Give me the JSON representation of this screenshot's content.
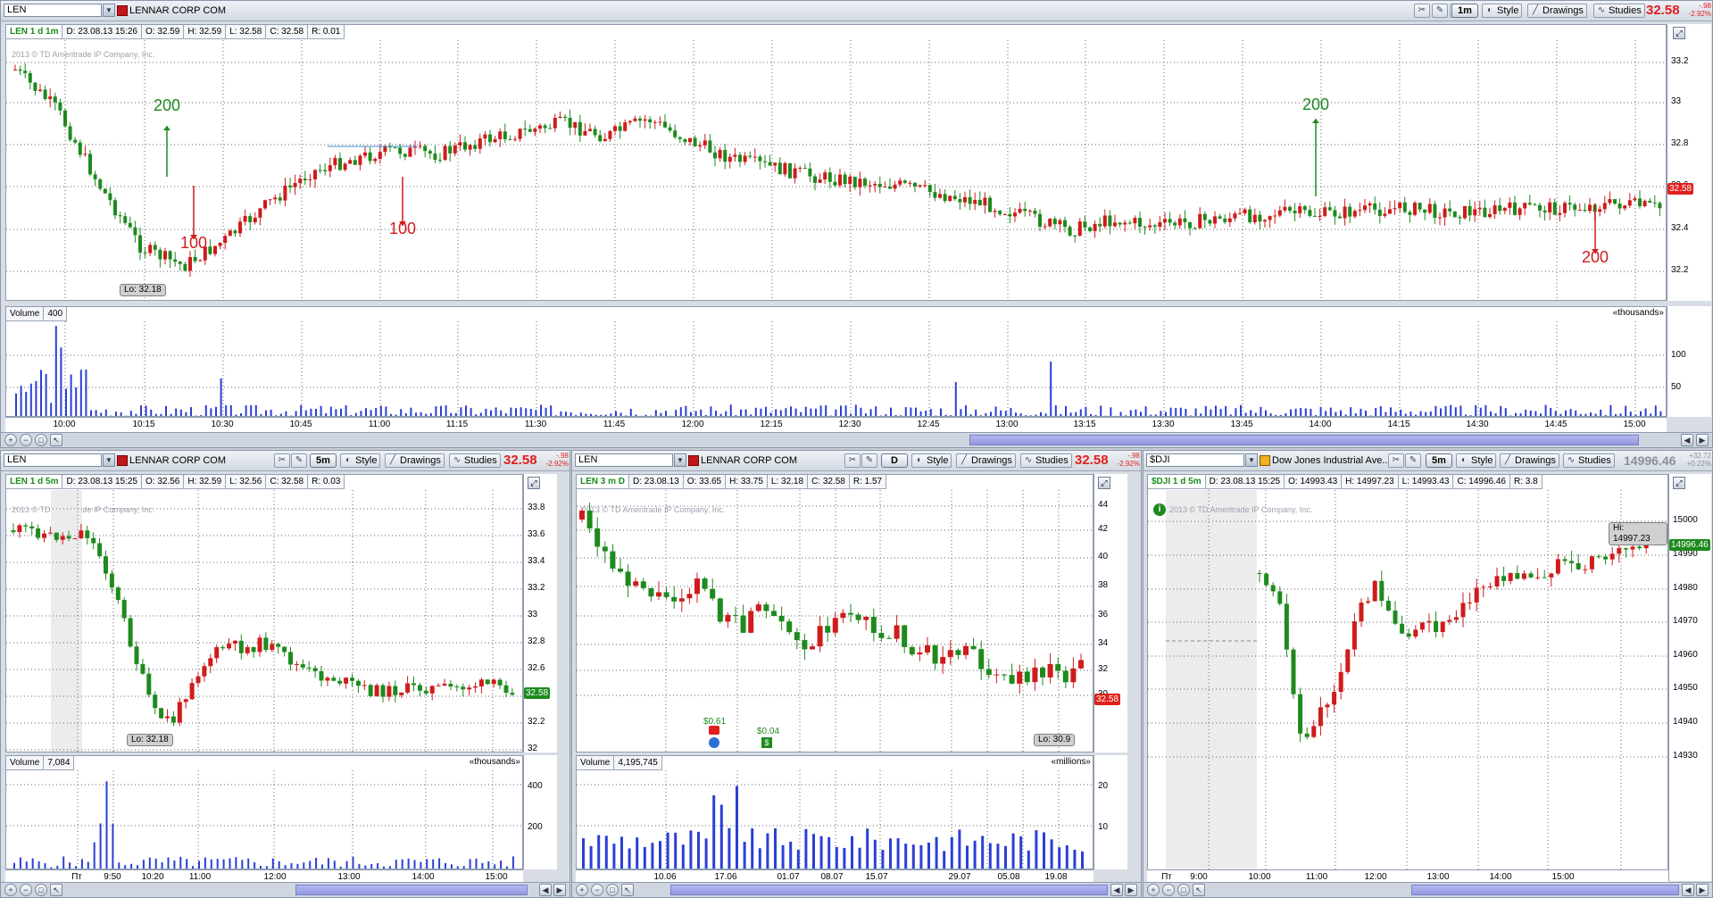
{
  "colors": {
    "up": "#1e8a1e",
    "down": "#cf1b1b",
    "volume": "#2a3fd6",
    "last_bg": "#e0201c",
    "last_bg_dji": "#1e8a1e"
  },
  "toolbar": {
    "style": "Style",
    "drawings": "Drawings",
    "studies": "Studies"
  },
  "top": {
    "symbol": "LEN",
    "company": "LENNAR CORP COM",
    "aggregation": "1m",
    "last": "32.58",
    "chg": "-.98",
    "chg_pct": "-2.92%",
    "info": {
      "title": "LEN 1 d 1m",
      "d": "D: 23.08.13 15:26",
      "o": "O: 32.59",
      "h": "H: 32.59",
      "l": "L: 32.58",
      "c": "C: 32.58",
      "r": "R: 0.01"
    },
    "copyright": "2013 © TD Ameritrade IP Company, Inc.",
    "yticks": [
      "33.2",
      "33",
      "32.8",
      "32.6",
      "32.4",
      "32.2"
    ],
    "price_tag": "32.58",
    "lo": "Lo: 32.18",
    "annotations": [
      {
        "text": "200",
        "color": "up"
      },
      {
        "text": "100",
        "color": "down"
      },
      {
        "text": "100",
        "color": "down"
      },
      {
        "text": "200",
        "color": "up"
      },
      {
        "text": "200",
        "color": "down"
      }
    ],
    "volume": {
      "label": "Volume",
      "value": "400",
      "unit": "«thousands»",
      "ticks": [
        "100",
        "50"
      ]
    },
    "xticks": [
      "10:00",
      "10:15",
      "10:30",
      "10:45",
      "11:00",
      "11:15",
      "11:30",
      "11:45",
      "12:00",
      "12:15",
      "12:30",
      "12:45",
      "13:00",
      "13:15",
      "13:30",
      "13:45",
      "14:00",
      "14:15",
      "14:30",
      "14:45",
      "15:00"
    ]
  },
  "bl": {
    "symbol": "LEN",
    "company": "LENNAR CORP COM",
    "aggregation": "5m",
    "last": "32.58",
    "chg": "-.98",
    "chg_pct": "-2.92%",
    "info": {
      "title": "LEN 1 d 5m",
      "d": "D: 23.08.13 15:25",
      "o": "O: 32.56",
      "h": "H: 32.59",
      "l": "L: 32.56",
      "c": "C: 32.58",
      "r": "R: 0.03"
    },
    "copyright": "2013 © TD Ameritrade IP Company, Inc.",
    "yticks": [
      "33.8",
      "33.6",
      "33.4",
      "33.2",
      "33",
      "32.8",
      "32.6",
      "32.4",
      "32.2",
      "32"
    ],
    "price_tag": "32.58",
    "lo": "Lo: 32.18",
    "volume": {
      "label": "Volume",
      "value": "7,084",
      "unit": "«thousands»",
      "ticks": [
        "400",
        "200"
      ]
    },
    "xticks": [
      "Пт",
      "9:50",
      "10:20",
      "11:00",
      "12:00",
      "13:00",
      "14:00",
      "15:00"
    ]
  },
  "bm": {
    "symbol": "LEN",
    "company": "LENNAR CORP COM",
    "aggregation": "D",
    "last": "32.58",
    "chg": "-.98",
    "chg_pct": "-2.92%",
    "info": {
      "title": "LEN 3 m D",
      "d": "D: 23.08.13",
      "o": "O: 33.65",
      "h": "H: 33.75",
      "l": "L: 32.18",
      "c": "C: 32.58",
      "r": "R: 1.57"
    },
    "copyright": "2013 © TD Ameritrade IP Company, Inc.",
    "yticks": [
      "44",
      "42",
      "40",
      "38",
      "36",
      "34",
      "32",
      "30"
    ],
    "price_tag": "32.58",
    "lo": "Lo: 30.9",
    "div1": "$0.61",
    "div2": "$0.04",
    "volume": {
      "label": "Volume",
      "value": "4,195,745",
      "unit": "«millions»",
      "ticks": [
        "20",
        "10"
      ]
    },
    "xticks": [
      "10.06",
      "17.06",
      "01.07",
      "08.07",
      "15.07",
      "29.07",
      "05.08",
      "19.08"
    ]
  },
  "br": {
    "symbol": "$DJI",
    "company": "Dow Jones Industrial Ave...",
    "aggregation": "5m",
    "last": "14996.46",
    "chg": "+32.72",
    "chg_pct": "+0.22%",
    "info": {
      "title": "$DJI 1 d 5m",
      "d": "D: 23.08.13 15:25",
      "o": "O: 14993.43",
      "h": "H: 14997.23",
      "l": "L: 14993.43",
      "c": "C: 14996.46",
      "r": "R: 3.8"
    },
    "copyright": "2013 © TD Ameritrade IP Company, Inc.",
    "yticks": [
      "15000",
      "14990",
      "14980",
      "14970",
      "14960",
      "14950",
      "14940",
      "14930"
    ],
    "price_tag": "14996.46",
    "hi": "Hi: 14997.23",
    "xticks": [
      "Пт",
      "9:00",
      "10:00",
      "11:00",
      "12:00",
      "13:00",
      "14:00",
      "15:00"
    ]
  }
}
